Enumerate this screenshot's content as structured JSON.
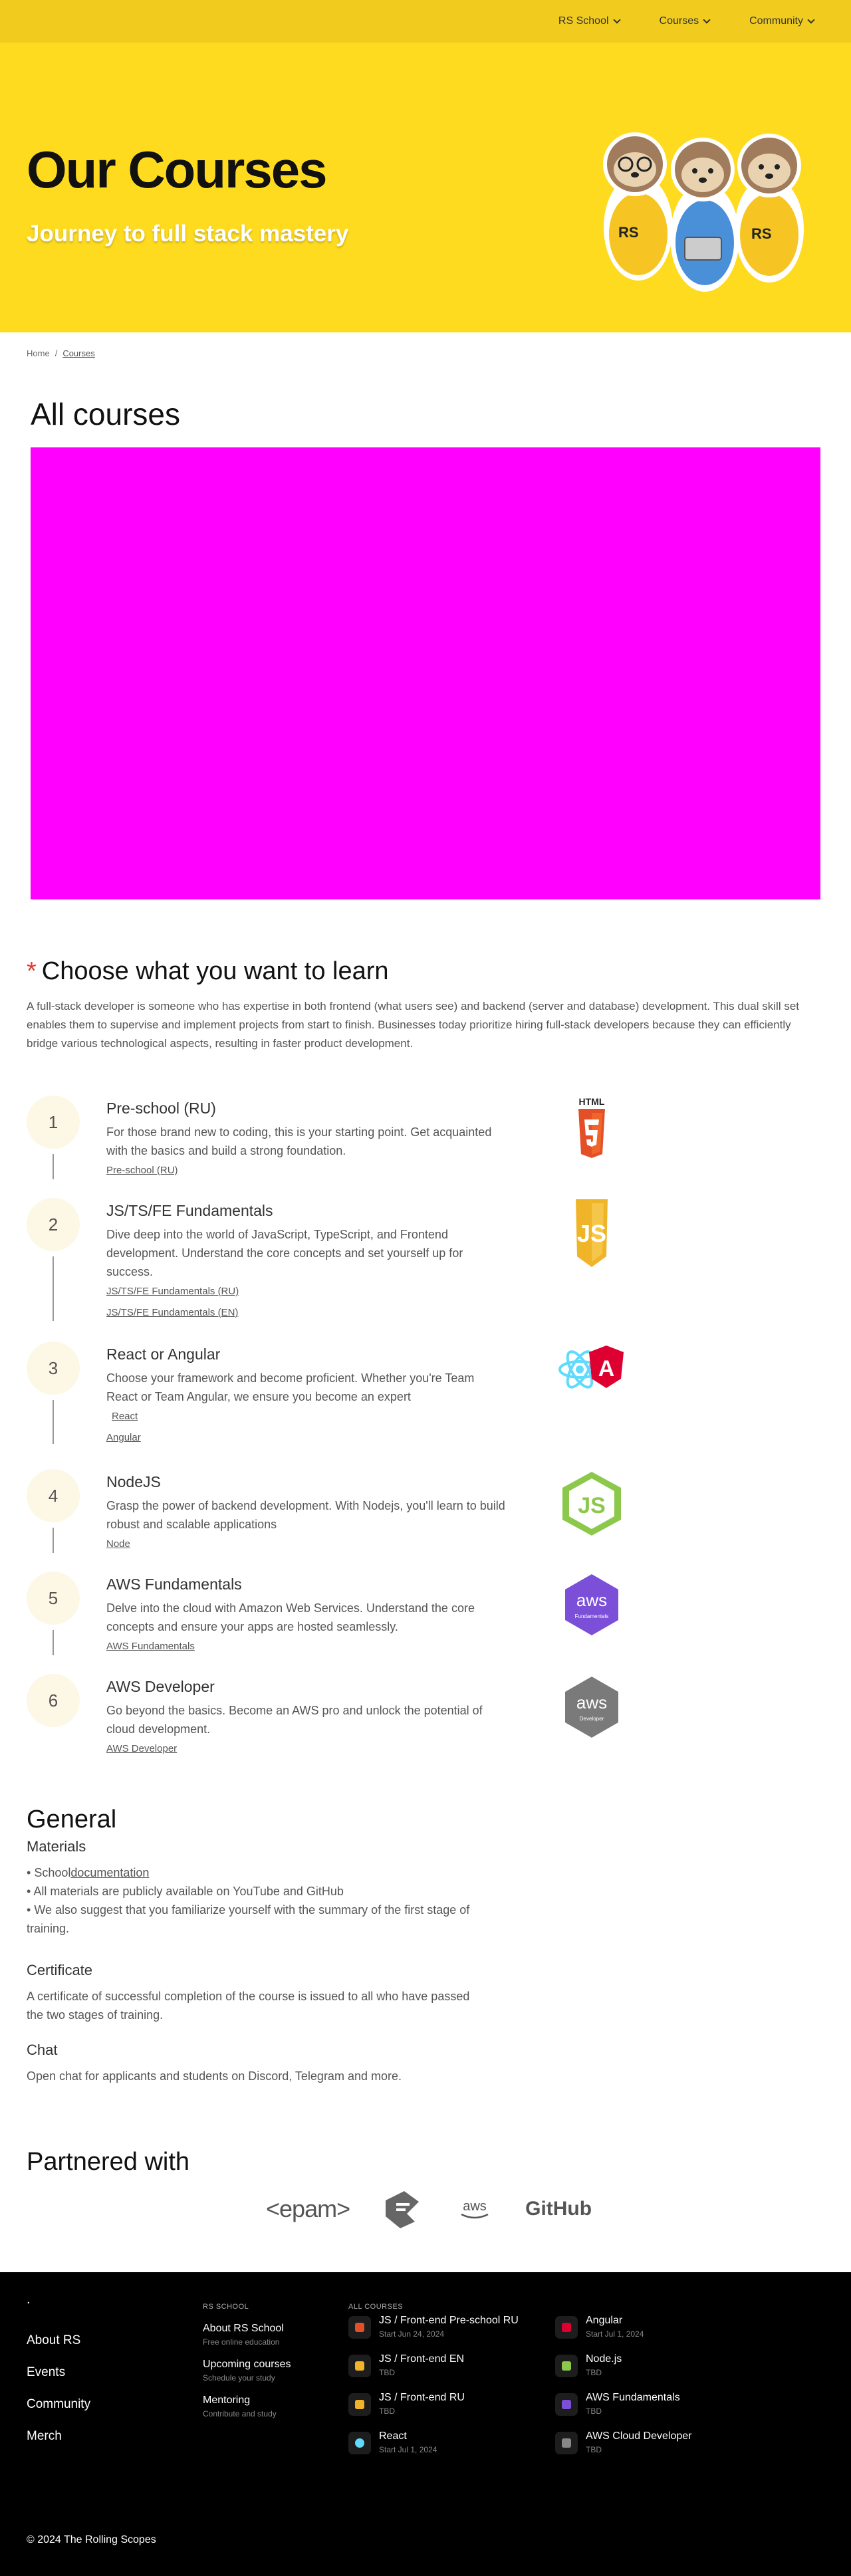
{
  "nav": {
    "items": [
      {
        "label": "RS School"
      },
      {
        "label": "Courses"
      },
      {
        "label": "Community"
      }
    ]
  },
  "hero": {
    "title": "Our Courses",
    "subtitle": "Journey to full stack mastery",
    "mascot_text": "RS"
  },
  "breadcrumb": {
    "home": "Home",
    "separator": "/",
    "current": "Courses"
  },
  "main": {
    "title": "All courses"
  },
  "learn": {
    "title": "Choose what you want to learn",
    "star": "*",
    "intro": "A full-stack developer is someone who has expertise in both frontend (what users see) and backend (server and database) development. This dual skill set enables them to supervise and implement projects from start to finish. Businesses today prioritize hiring full-stack developers because they can efficiently bridge various technological aspects, resulting in faster product development.",
    "courses": [
      {
        "num": "1",
        "title": "Pre-school (RU)",
        "desc": "For those brand new to coding, this is your starting point. Get acquainted with the basics and build a strong foundation.",
        "links": [
          "Pre-school (RU)"
        ],
        "logo": "html5-icon",
        "logo_text": "HTML",
        "color": "#e34f26"
      },
      {
        "num": "2",
        "title": "JS/TS/FE Fundamentals",
        "desc": "Dive deep into the world of JavaScript, TypeScript, and Frontend development. Understand the core concepts and set yourself up for success.",
        "links": [
          "JS/TS/FE Fundamentals (RU)",
          "JS/TS/FE Fundamentals (EN)"
        ],
        "logo": "js-icon",
        "logo_text": "JS",
        "color": "#f0b429"
      },
      {
        "num": "3",
        "title": "React or Angular",
        "desc": "Choose your framework and become proficient. Whether you're Team React or Team Angular, we ensure you become an expert",
        "links": [
          "React",
          "Angular"
        ],
        "logo": "react-angular-icon",
        "logo_text": "A",
        "color": "#dd0031"
      },
      {
        "num": "4",
        "title": "NodeJS",
        "desc": "Grasp the power of backend development. With Nodejs, you'll learn to build robust and scalable applications",
        "links": [
          "Node"
        ],
        "logo": "nodejs-icon",
        "logo_text": "JS",
        "color": "#8cc84b"
      },
      {
        "num": "5",
        "title": "AWS Fundamentals",
        "desc": "Delve into the cloud with Amazon Web Services. Understand the core concepts and ensure your apps are hosted seamlessly.",
        "links": [
          "AWS Fundamentals"
        ],
        "logo": "aws-fundamentals-icon",
        "logo_text": "aws",
        "logo_sub": "Fundamentals",
        "color": "#7b4fd8"
      },
      {
        "num": "6",
        "title": "AWS Developer",
        "desc": "Go beyond the basics. Become an AWS pro and unlock the potential of cloud development.",
        "links": [
          "AWS Developer"
        ],
        "logo": "aws-developer-icon",
        "logo_text": "aws",
        "logo_sub": "Developer",
        "color": "#7a7a7a"
      }
    ]
  },
  "general": {
    "title": "General",
    "materials_title": "Materials",
    "materials": {
      "item1_prefix": "School",
      "item1_link": "documentation",
      "item2": "All materials are publicly available on YouTube and GitHub",
      "item3": "We also suggest that you familiarize yourself with the summary of the first stage of training."
    },
    "certificate_title": "Certificate",
    "certificate_text": "A certificate of successful completion of the course is issued to all who have passed the two stages of training.",
    "chat_title": "Chat",
    "chat_text": "Open chat for applicants and students on Discord, Telegram and more."
  },
  "partners": {
    "title": "Partnered with",
    "epam": "<epam>",
    "aws": "aws",
    "github": "GitHub"
  },
  "footer": {
    "dot": ".",
    "links": [
      "About RS",
      "Events",
      "Community",
      "Merch"
    ],
    "rs_title": "RS SCHOOL",
    "rs_items": [
      {
        "title": "About RS School",
        "sub": "Free online education"
      },
      {
        "title": "Upcoming courses",
        "sub": "Schedule your study"
      },
      {
        "title": "Mentoring",
        "sub": "Contribute and study"
      }
    ],
    "courses_title": "ALL COURSES",
    "courses": [
      {
        "title": "JS / Front-end Pre-school RU",
        "sub": "Start Jun 24, 2024",
        "color": "#e34f26"
      },
      {
        "title": "JS / Front-end EN",
        "sub": "TBD",
        "color": "#f0b429"
      },
      {
        "title": "JS / Front-end RU",
        "sub": "TBD",
        "color": "#f0b429"
      },
      {
        "title": "React",
        "sub": "Start Jul 1, 2024",
        "color": "#61dafb"
      },
      {
        "title": "Angular",
        "sub": "Start Jul 1, 2024",
        "color": "#dd0031"
      },
      {
        "title": "Node.js",
        "sub": "TBD",
        "color": "#8cc84b"
      },
      {
        "title": "AWS Fundamentals",
        "sub": "TBD",
        "color": "#7b4fd8"
      },
      {
        "title": "AWS Cloud Developer",
        "sub": "TBD",
        "color": "#888888"
      }
    ],
    "copyright": "© 2024 The Rolling Scopes"
  }
}
